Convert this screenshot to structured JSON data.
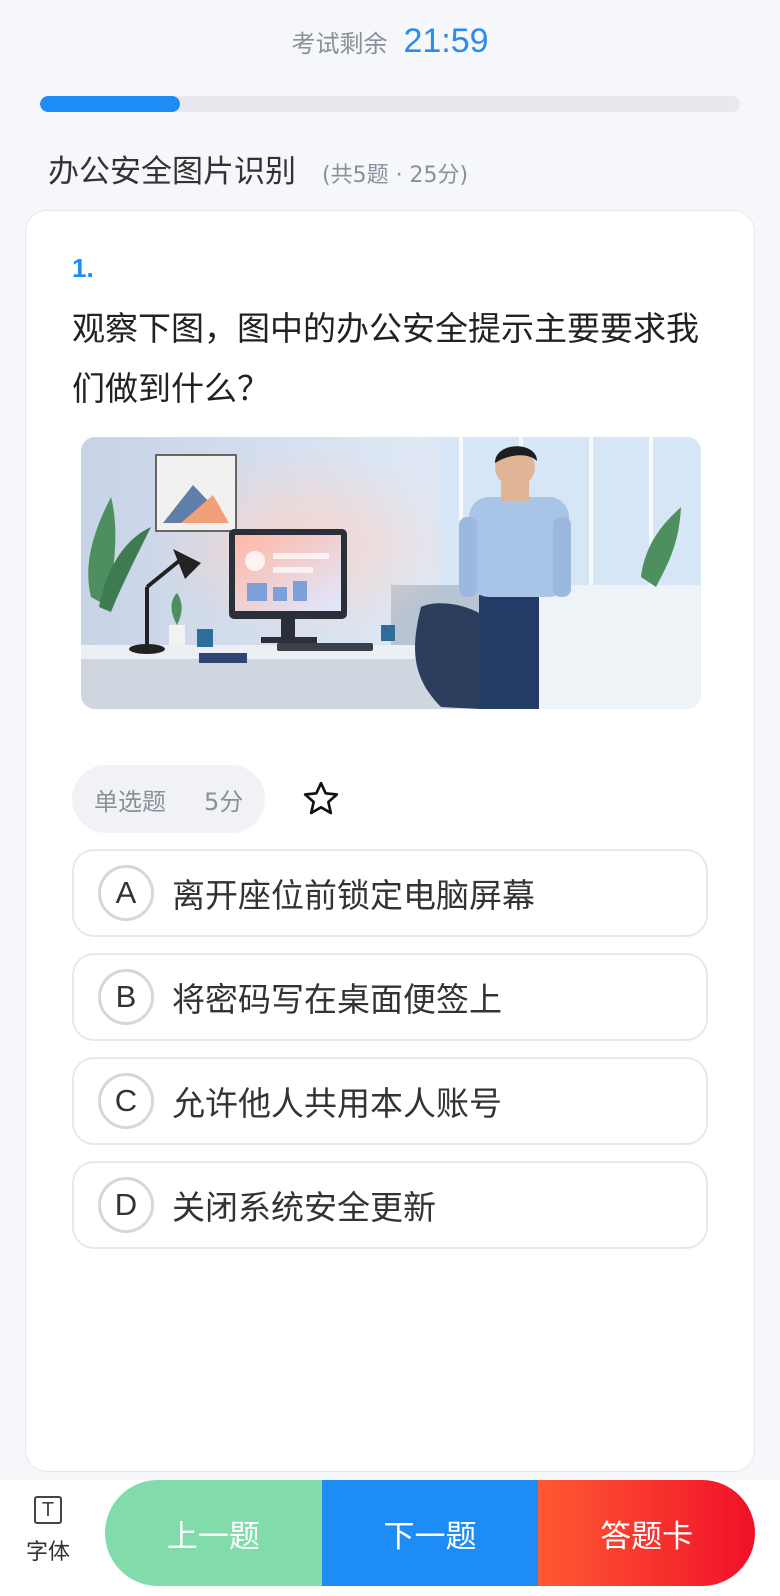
{
  "header": {
    "timer_label": "考试剩余",
    "timer_value": "21:59",
    "progress_fraction": 0.2
  },
  "section": {
    "title": "办公安全图片识别",
    "meta": "(共5题 · 25分)"
  },
  "question": {
    "number": "1.",
    "text": "观察下图，图中的办公安全提示主要要求我们做到什么？",
    "type": "单选题",
    "score": "5分",
    "image_icon": "office-scene-image",
    "favorite_icon": "star-outline-icon"
  },
  "options": [
    {
      "letter": "A",
      "text": "离开座位前锁定电脑屏幕"
    },
    {
      "letter": "B",
      "text": "将密码写在桌面便签上"
    },
    {
      "letter": "C",
      "text": "允许他人共用本人账号"
    },
    {
      "letter": "D",
      "text": "关闭系统安全更新"
    }
  ],
  "footer": {
    "font_icon": "T",
    "font_label": "字体",
    "prev_label": "上一题",
    "next_label": "下一题",
    "card_label": "答题卡"
  },
  "colors": {
    "accent": "#1e8cf5",
    "prev": "#82dbaa",
    "card_start": "#ff5a33",
    "card_end": "#f01028"
  }
}
